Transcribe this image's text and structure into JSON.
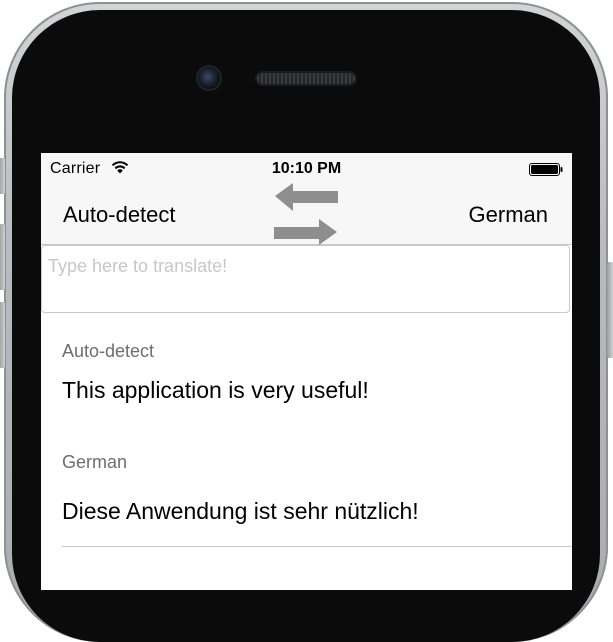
{
  "status_bar": {
    "carrier": "Carrier",
    "time": "10:10 PM"
  },
  "nav": {
    "source_language": "Auto-detect",
    "target_language": "German",
    "swap_icon": "swap-arrows-icon"
  },
  "input": {
    "placeholder": "Type here to translate!",
    "value": ""
  },
  "results": {
    "source": {
      "language": "Auto-detect",
      "text": "This application is very useful!"
    },
    "target": {
      "language": "German",
      "text": "Diese Anwendung ist sehr nützlich!"
    }
  },
  "colors": {
    "arrow": "#8e8e8e",
    "bar_background": "#f7f7f7",
    "label_gray": "#6d6d72",
    "placeholder_gray": "#c7c7cd"
  }
}
